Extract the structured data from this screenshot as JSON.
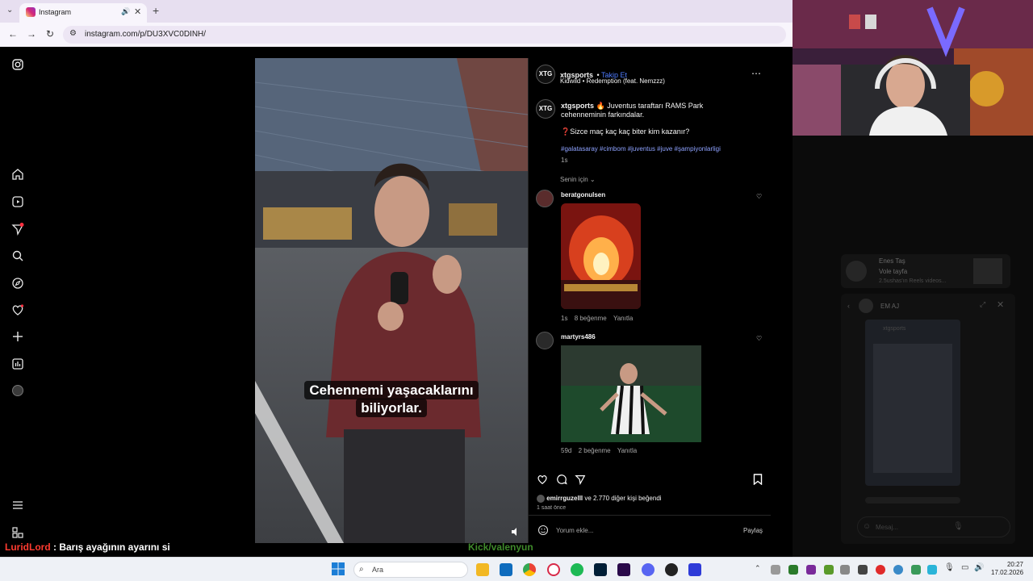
{
  "browser": {
    "tab_title": "Instagram",
    "url": "instagram.com/p/DU3XVC0DINH/"
  },
  "post": {
    "username": "xtgsports",
    "follow_label": "Takip Et",
    "audio": "Kidwild • Redemption (feat. Nemzzz)",
    "avatar_text": "XTG",
    "caption_line1": "Juventus taraftarı RAMS Park cehenneminin farkındalar.",
    "caption_question": "Sizce maç kaç kaç biter kim kazanır?",
    "hashtags": "#galatasaray #cimbom #juventus #juve #şampiyonlarligi",
    "time": "1s",
    "sort_label": "Senin için",
    "video_caption_1": "Cehennemi yaşacaklarını",
    "video_caption_2": "biliyorlar.",
    "likes_text_user": "emirrguzelll",
    "likes_text_rest": " ve 2.770 diğer kişi beğendi",
    "posted_ago": "1 saat önce",
    "comment_placeholder": "Yorum ekle...",
    "share_label": "Paylaş"
  },
  "comments": [
    {
      "user": "beratgonulsen",
      "time": "1s",
      "likes": "8 beğenme",
      "reply": "Yanıtla"
    },
    {
      "user": "martyrs486",
      "time": "59d",
      "likes": "2 beğenme",
      "reply": "Yanıtla"
    }
  ],
  "dm": {
    "card_name": "Enes Taş",
    "card_line1": "Vole tayfa",
    "card_line2": "2.5ushas'ın Reels videos...",
    "chat_title": "EM AJ",
    "chat_preview_user": "xtgsports",
    "message_placeholder": "Mesaj..."
  },
  "stream_chat": {
    "user": "LuridLord",
    "message": " : Barış ayağının ayarını si"
  },
  "watermark": "Kick/valenyun",
  "taskbar": {
    "search_label": "Ara",
    "time": "20:27",
    "date": "17.02.2026"
  },
  "colors": {
    "accent_link": "#8ea2ff",
    "follow": "#4f7cff",
    "chat_user": "#ff3b30"
  }
}
